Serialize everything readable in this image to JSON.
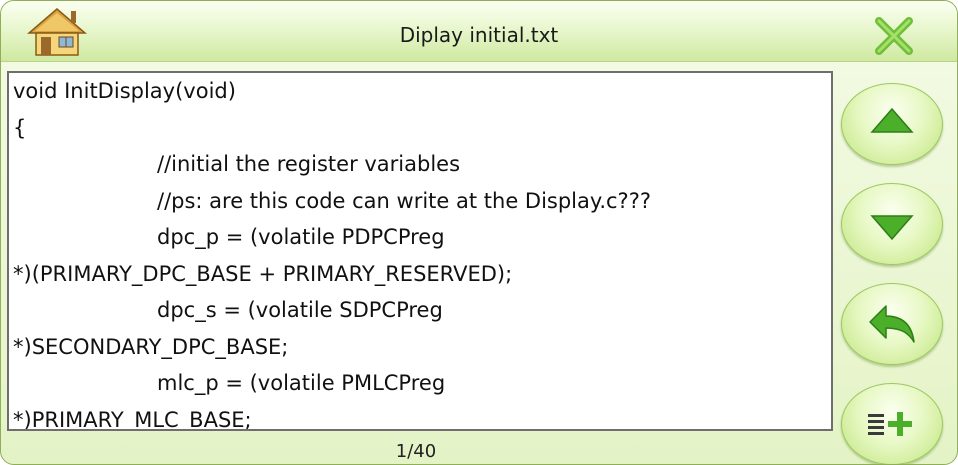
{
  "window": {
    "title": "Diplay initial.txt"
  },
  "icons": {
    "home": "home-icon",
    "close": "close-icon",
    "scroll_up": "triangle-up-icon",
    "scroll_down": "triangle-down-icon",
    "back": "back-arrow-icon",
    "add_list": "list-add-icon"
  },
  "colors": {
    "accent_green": "#4caf2a",
    "button_gradient_light": "#fbfff0",
    "button_gradient_dark": "#bfe47a",
    "close_x": "#6fbf3a"
  },
  "content": {
    "lines": [
      "void InitDisplay(void)",
      "{",
      "//initial the register variables",
      "//ps: are this code can write at the Display.c???",
      "dpc_p = (volatile PDPCPreg",
      "*)(PRIMARY_DPC_BASE + PRIMARY_RESERVED);",
      "dpc_s = (volatile SDPCPreg",
      "*)SECONDARY_DPC_BASE;",
      "mlc_p = (volatile PMLCPreg",
      "*)PRIMARY_MLC_BASE;"
    ]
  },
  "pager": {
    "text": "1/40"
  }
}
